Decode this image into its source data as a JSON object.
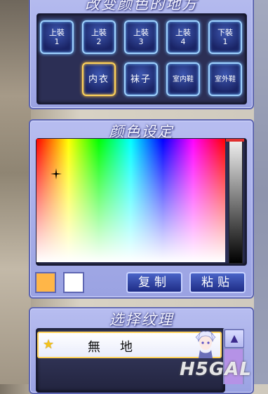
{
  "parts_panel": {
    "title": "改变颜色的地方",
    "buttons": [
      {
        "line1": "上裝",
        "line2": "1"
      },
      {
        "line1": "上裝",
        "line2": "2"
      },
      {
        "line1": "上裝",
        "line2": "3"
      },
      {
        "line1": "上裝",
        "line2": "4"
      },
      {
        "line1": "下裝",
        "line2": "1"
      }
    ],
    "buttons_row2": [
      "内衣",
      "袜子",
      "室内鞋",
      "室外鞋"
    ],
    "selected": "内衣"
  },
  "color_panel": {
    "title": "颜色设定",
    "swatch_current": "#ffb648",
    "swatch_secondary": "#ffffff",
    "copy_label": "复制",
    "paste_label": "粘贴"
  },
  "texture_panel": {
    "title": "选择纹理",
    "items": [
      {
        "label": "無地",
        "starred": true
      }
    ],
    "scroll_up": "▲"
  },
  "watermark": "H5GAL"
}
